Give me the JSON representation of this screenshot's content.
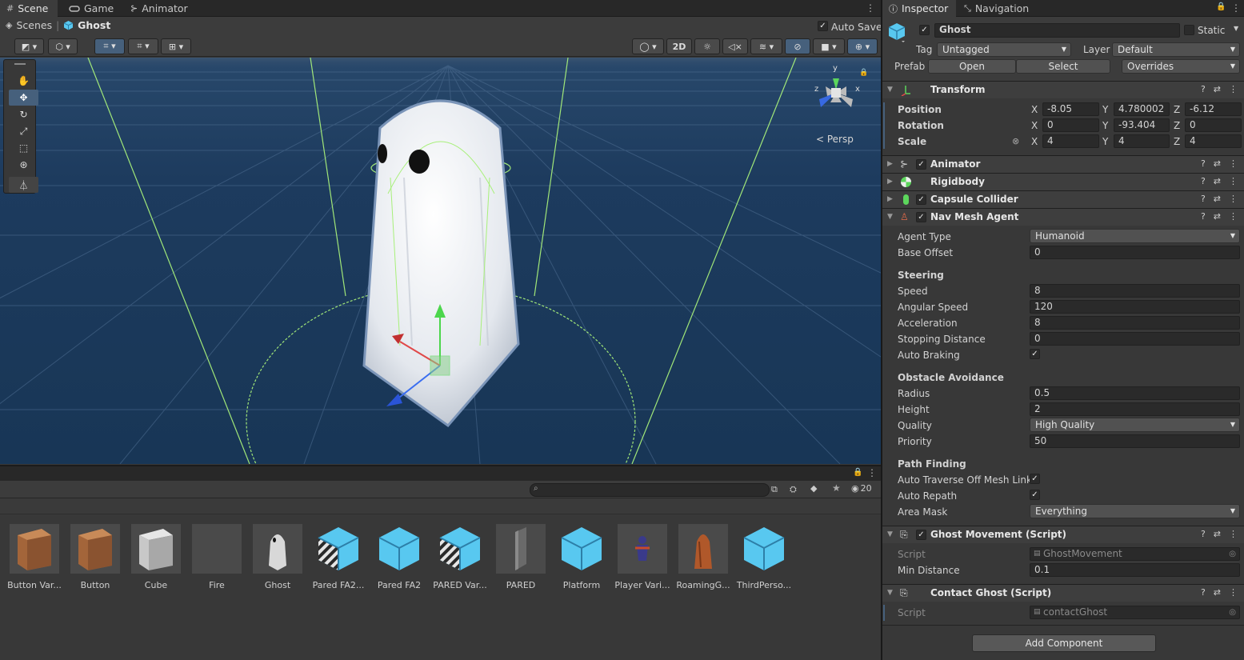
{
  "tabs": {
    "scene": "Scene",
    "game": "Game",
    "animator": "Animator"
  },
  "breadcrumb": {
    "scenes": "Scenes",
    "current": "Ghost"
  },
  "autosave": {
    "label": "Auto Save",
    "checked": true
  },
  "scene_toolbar": {
    "mode_2d": "2D",
    "persp_label": "< Persp",
    "gizmo_y": "y",
    "gizmo_z": "z",
    "gizmo_x": "x"
  },
  "project": {
    "search_placeholder": "",
    "hidden_count": "20",
    "assets": [
      {
        "name": "Button Var...",
        "kind": "cube-brown"
      },
      {
        "name": "Button",
        "kind": "cube-brown"
      },
      {
        "name": "Cube",
        "kind": "cube-gray"
      },
      {
        "name": "Fire",
        "kind": "empty"
      },
      {
        "name": "Ghost",
        "kind": "ghost"
      },
      {
        "name": "Pared FA2...",
        "kind": "prefab-variant"
      },
      {
        "name": "Pared FA2",
        "kind": "prefab"
      },
      {
        "name": "PARED Var...",
        "kind": "prefab-variant"
      },
      {
        "name": "PARED",
        "kind": "wall"
      },
      {
        "name": "Platform",
        "kind": "prefab"
      },
      {
        "name": "Player Vari...",
        "kind": "player"
      },
      {
        "name": "RoamingG...",
        "kind": "roaming"
      },
      {
        "name": "ThirdPerso...",
        "kind": "prefab"
      }
    ]
  },
  "inspector": {
    "tabs": {
      "inspector": "Inspector",
      "navigation": "Navigation"
    },
    "object_name": "Ghost",
    "static_label": "Static",
    "tag_label": "Tag",
    "tag_value": "Untagged",
    "layer_label": "Layer",
    "layer_value": "Default",
    "prefab_label": "Prefab",
    "prefab_open": "Open",
    "prefab_select": "Select",
    "prefab_overrides": "Overrides",
    "transform": {
      "title": "Transform",
      "position_label": "Position",
      "position": {
        "x": "-8.05",
        "y": "4.780002",
        "z": "-6.12"
      },
      "rotation_label": "Rotation",
      "rotation": {
        "x": "0",
        "y": "-93.404",
        "z": "0"
      },
      "scale_label": "Scale",
      "scale": {
        "x": "4",
        "y": "4",
        "z": "4"
      }
    },
    "components": {
      "animator": "Animator",
      "rigidbody": "Rigidbody",
      "capsule": "Capsule Collider",
      "navmesh": "Nav Mesh Agent"
    },
    "navmesh": {
      "agent_type_label": "Agent Type",
      "agent_type": "Humanoid",
      "base_offset_label": "Base Offset",
      "base_offset": "0",
      "steering_header": "Steering",
      "speed_label": "Speed",
      "speed": "8",
      "angular_speed_label": "Angular Speed",
      "angular_speed": "120",
      "acceleration_label": "Acceleration",
      "acceleration": "8",
      "stopping_distance_label": "Stopping Distance",
      "stopping_distance": "0",
      "auto_braking_label": "Auto Braking",
      "obstacle_header": "Obstacle Avoidance",
      "radius_label": "Radius",
      "radius": "0.5",
      "height_label": "Height",
      "height": "2",
      "quality_label": "Quality",
      "quality": "High Quality",
      "priority_label": "Priority",
      "priority": "50",
      "pathfinding_header": "Path Finding",
      "auto_traverse_label": "Auto Traverse Off Mesh Link",
      "auto_repath_label": "Auto Repath",
      "area_mask_label": "Area Mask",
      "area_mask": "Everything"
    },
    "ghost_movement": {
      "title": "Ghost Movement (Script)",
      "script_label": "Script",
      "script": "GhostMovement",
      "min_distance_label": "Min Distance",
      "min_distance": "0.1"
    },
    "contact_ghost": {
      "title": "Contact Ghost (Script)",
      "script_label": "Script",
      "script": "contactGhost"
    },
    "add_component": "Add Component"
  },
  "colors": {
    "accent": "#46607c",
    "scene_sky": "#1a3a5c",
    "panel": "#383838",
    "field": "#2a2a2a"
  }
}
